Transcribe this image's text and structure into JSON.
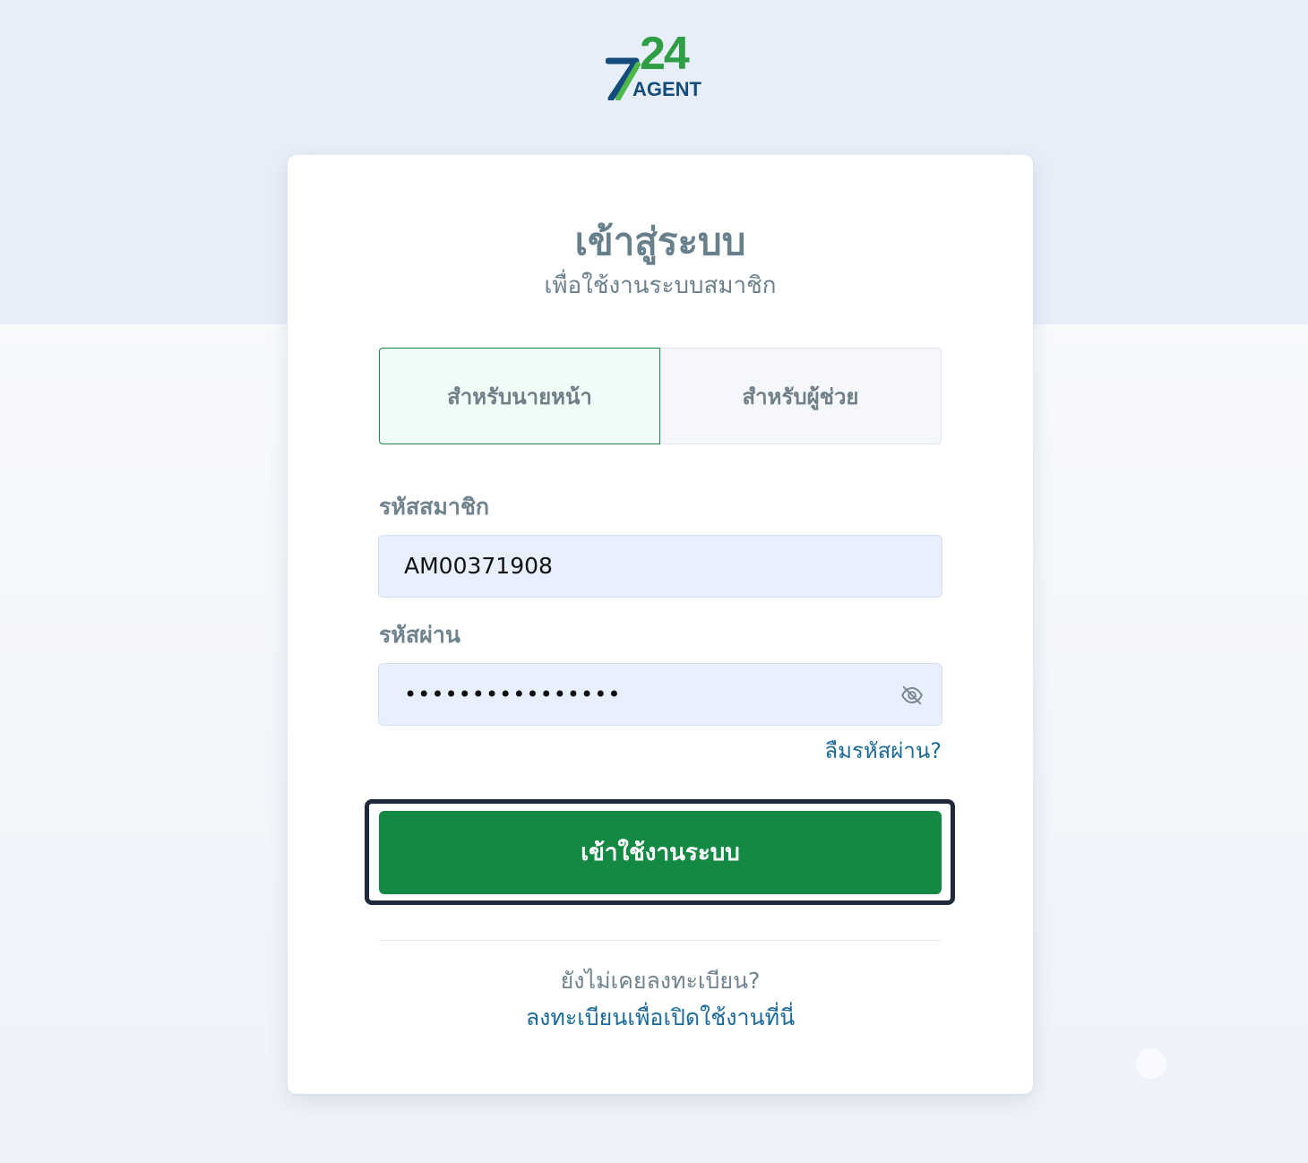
{
  "brand": {
    "logo_number": "24",
    "logo_word": "AGENT",
    "logo_mark": "7"
  },
  "header": {
    "title": "เข้าสู่ระบบ",
    "subtitle": "เพื่อใช้งานระบบสมาชิก"
  },
  "tabs": [
    {
      "label": "สำหรับนายหน้า",
      "active": true
    },
    {
      "label": "สำหรับผู้ช่วย",
      "active": false
    }
  ],
  "form": {
    "username_label": "รหัสสมาชิก",
    "username_value": "AM00371908",
    "password_label": "รหัสผ่าน",
    "password_value": "••••••••••••••••",
    "password_toggle_icon": "eye-off-icon",
    "forgot_label": "ลืมรหัสผ่าน?",
    "submit_label": "เข้าใช้งานระบบ"
  },
  "footer": {
    "no_account": "ยังไม่เคยลงทะเบียน?",
    "register_link": "ลงทะเบียนเพื่อเปิดใช้งานที่นี่"
  },
  "colors": {
    "primary_green": "#138944",
    "brand_blue": "#134c7a",
    "link_blue": "#1a6a9c",
    "input_bg": "#e8f0fe",
    "top_band": "#e7eef8"
  }
}
